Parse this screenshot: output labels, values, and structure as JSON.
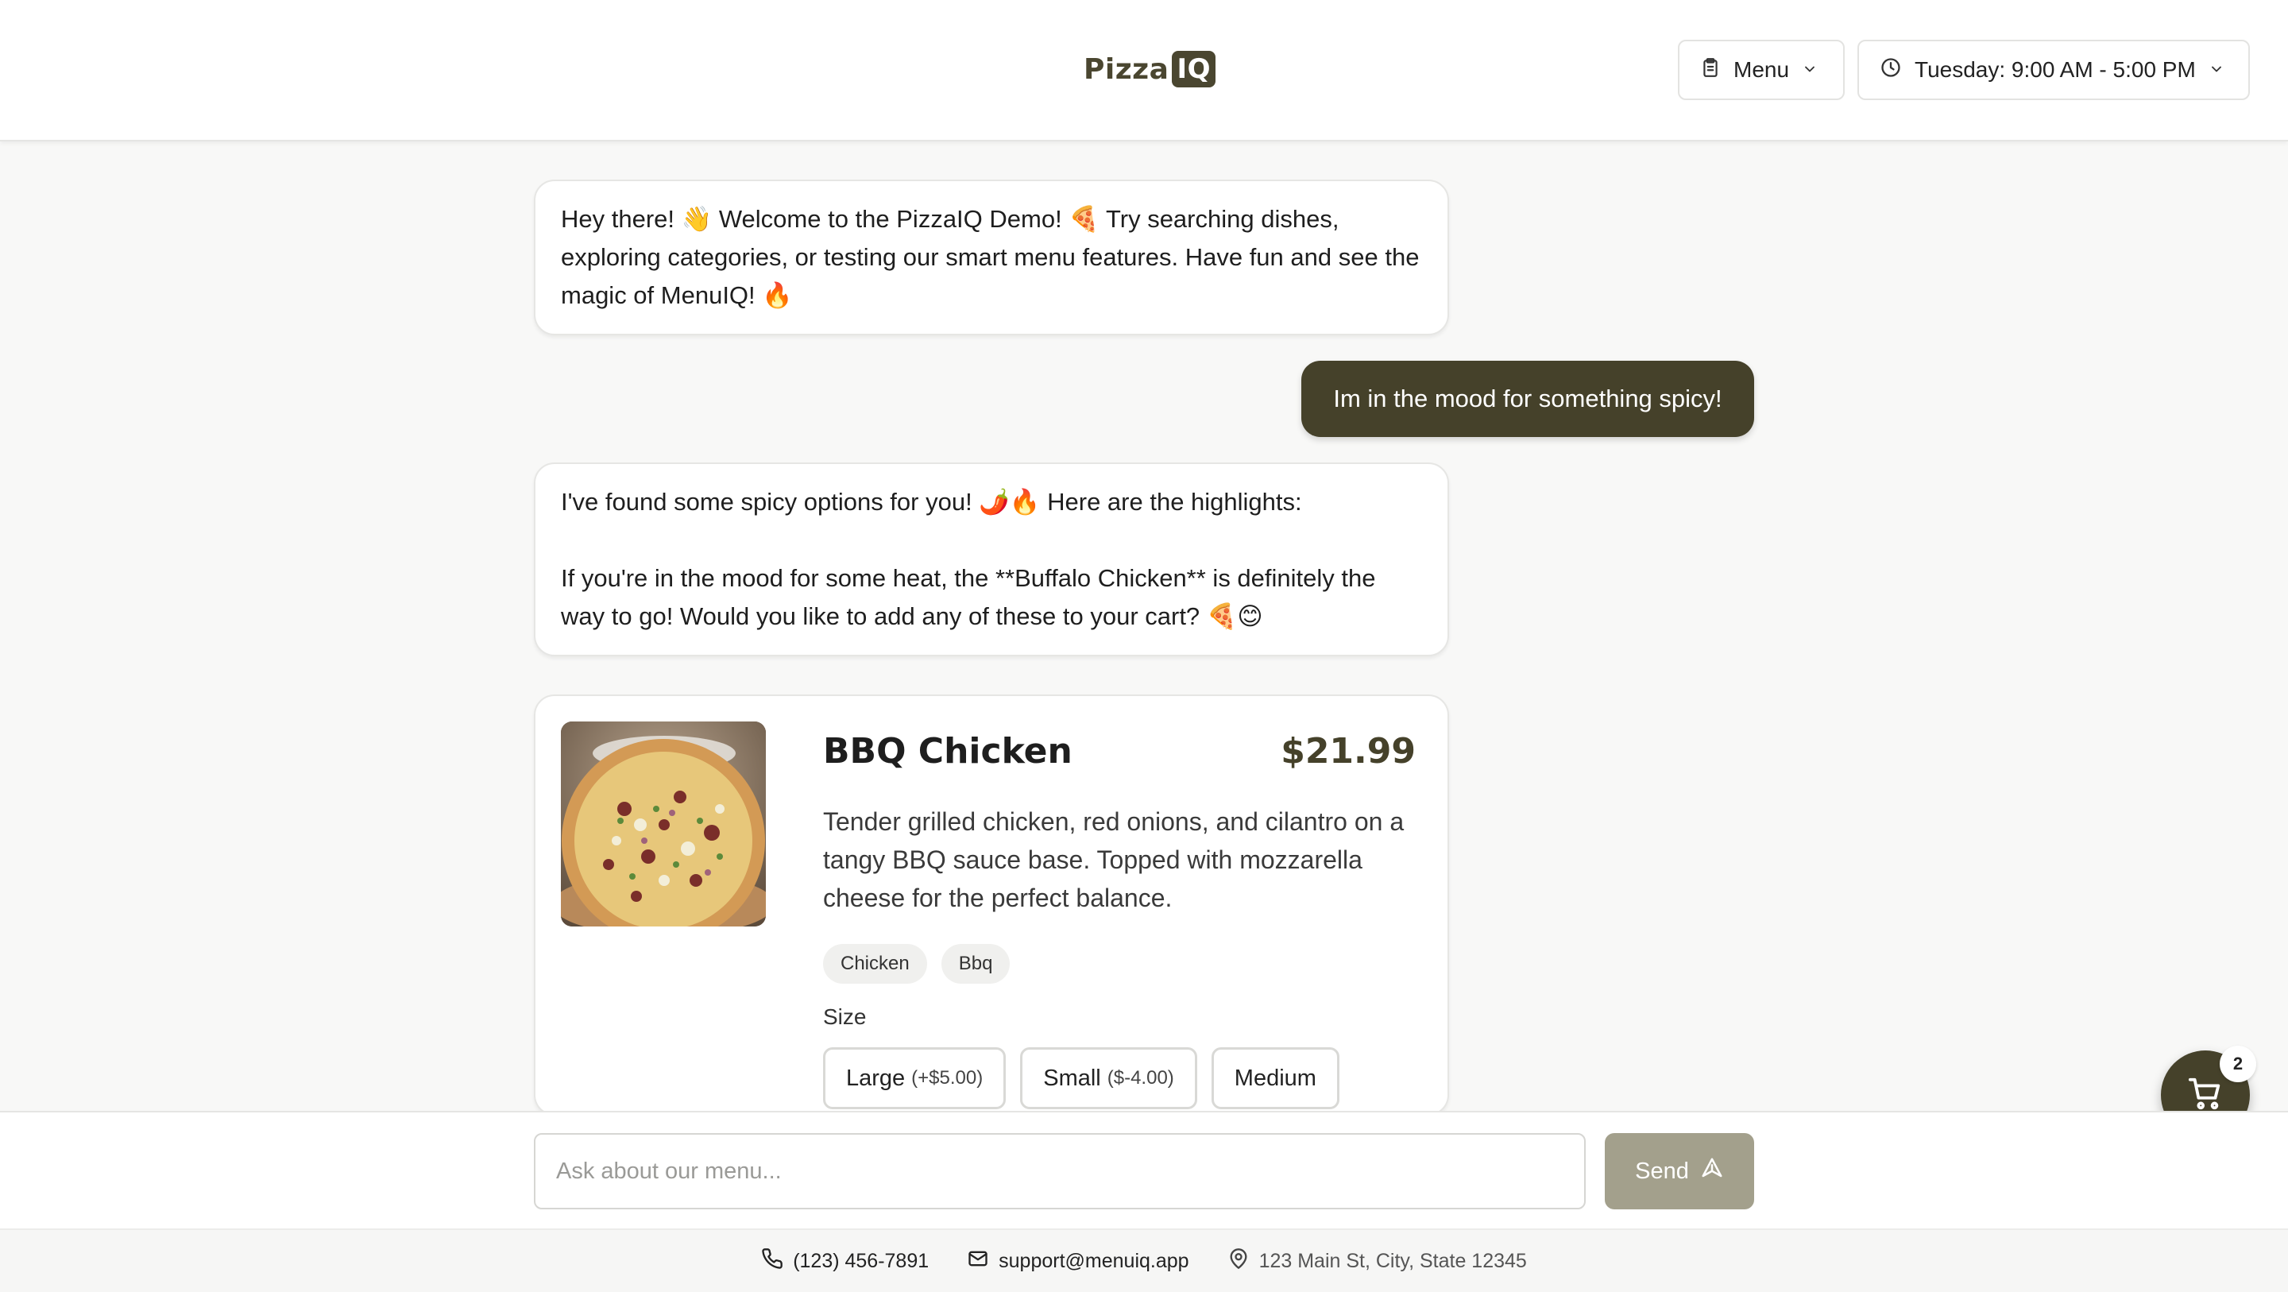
{
  "header": {
    "logo_text": "Pizza",
    "logo_badge": "IQ",
    "menu_label": "Menu",
    "hours_label": "Tuesday: 9:00 AM - 5:00 PM"
  },
  "messages": {
    "welcome": "Hey there! 👋 Welcome to the PizzaIQ Demo! 🍕 Try searching dishes, exploring categories, or testing our smart menu features. Have fun and see the magic of MenuIQ! 🔥",
    "user": "Im in the mood for something spicy!",
    "reply": "I've found some spicy options for you! 🌶️🔥 Here are the highlights:\n\nIf you're in the mood for some heat, the **Buffalo Chicken** is definitely the way to go! Would you like to add any of these to your cart? 🍕😊"
  },
  "product": {
    "name": "BBQ Chicken",
    "price": "$21.99",
    "description": "Tender grilled chicken, red onions, and cilantro on a tangy BBQ sauce base. Topped with mozzarella cheese for the perfect balance.",
    "tags": [
      "Chicken",
      "Bbq"
    ],
    "size_label": "Size",
    "sizes": [
      {
        "label": "Large",
        "modifier": "(+$5.00)"
      },
      {
        "label": "Small",
        "modifier": "($-4.00)"
      },
      {
        "label": "Medium",
        "modifier": ""
      }
    ]
  },
  "input": {
    "placeholder": "Ask about our menu...",
    "send_label": "Send"
  },
  "footer": {
    "phone": "(123) 456-7891",
    "email": "support@menuiq.app",
    "address": "123 Main St, City, State 12345"
  },
  "cart": {
    "count": "2"
  },
  "colors": {
    "brand": "#45412a",
    "send_disabled": "#a3a08c"
  }
}
